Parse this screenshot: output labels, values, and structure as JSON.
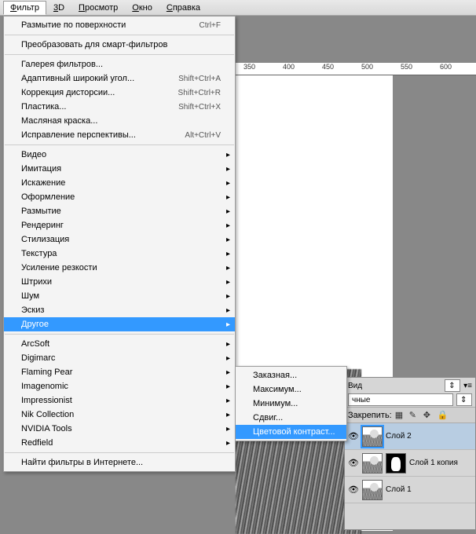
{
  "menubar": {
    "items": [
      {
        "label": "Фильтр",
        "u": 0,
        "active": true
      },
      {
        "label": "3D",
        "u": 0
      },
      {
        "label": "Просмотр",
        "u": 0
      },
      {
        "label": "Окно",
        "u": 0
      },
      {
        "label": "Справка",
        "u": 0
      }
    ]
  },
  "menu": {
    "items": [
      {
        "type": "item",
        "label": "Размытие по поверхности",
        "shortcut": "Ctrl+F"
      },
      {
        "type": "sep"
      },
      {
        "type": "item",
        "label": "Преобразовать для смарт-фильтров"
      },
      {
        "type": "sep"
      },
      {
        "type": "item",
        "label": "Галерея фильтров..."
      },
      {
        "type": "item",
        "label": "Адаптивный широкий угол...",
        "shortcut": "Shift+Ctrl+A"
      },
      {
        "type": "item",
        "label": "Коррекция дисторсии...",
        "shortcut": "Shift+Ctrl+R"
      },
      {
        "type": "item",
        "label": "Пластика...",
        "shortcut": "Shift+Ctrl+X"
      },
      {
        "type": "item",
        "label": "Масляная краска..."
      },
      {
        "type": "item",
        "label": "Исправление перспективы...",
        "shortcut": "Alt+Ctrl+V"
      },
      {
        "type": "sep"
      },
      {
        "type": "item",
        "label": "Видео",
        "sub": true
      },
      {
        "type": "item",
        "label": "Имитация",
        "sub": true
      },
      {
        "type": "item",
        "label": "Искажение",
        "sub": true
      },
      {
        "type": "item",
        "label": "Оформление",
        "sub": true
      },
      {
        "type": "item",
        "label": "Размытие",
        "sub": true
      },
      {
        "type": "item",
        "label": "Рендеринг",
        "sub": true
      },
      {
        "type": "item",
        "label": "Стилизация",
        "sub": true
      },
      {
        "type": "item",
        "label": "Текстура",
        "sub": true
      },
      {
        "type": "item",
        "label": "Усиление резкости",
        "sub": true
      },
      {
        "type": "item",
        "label": "Штрихи",
        "sub": true
      },
      {
        "type": "item",
        "label": "Шум",
        "sub": true
      },
      {
        "type": "item",
        "label": "Эскиз",
        "sub": true
      },
      {
        "type": "item",
        "label": "Другое",
        "sub": true,
        "highlight": true
      },
      {
        "type": "sep"
      },
      {
        "type": "item",
        "label": "ArcSoft",
        "sub": true
      },
      {
        "type": "item",
        "label": "Digimarc",
        "sub": true
      },
      {
        "type": "item",
        "label": "Flaming Pear",
        "sub": true
      },
      {
        "type": "item",
        "label": "Imagenomic",
        "sub": true
      },
      {
        "type": "item",
        "label": "Impressionist",
        "sub": true
      },
      {
        "type": "item",
        "label": "Nik Collection",
        "sub": true
      },
      {
        "type": "item",
        "label": "NVIDIA Tools",
        "sub": true
      },
      {
        "type": "item",
        "label": "Redfield",
        "sub": true
      },
      {
        "type": "sep"
      },
      {
        "type": "item",
        "label": "Найти фильтры в Интернете..."
      }
    ]
  },
  "submenu": {
    "items": [
      {
        "label": "Заказная..."
      },
      {
        "label": "Максимум..."
      },
      {
        "label": "Минимум..."
      },
      {
        "label": "Сдвиг..."
      },
      {
        "label": "Цветовой контраст...",
        "highlight": true
      }
    ]
  },
  "ruler": {
    "ticks": [
      "350",
      "400",
      "450",
      "500",
      "550",
      "600"
    ]
  },
  "panel": {
    "mode_label": "Вид",
    "blend_value": "чные",
    "lock_label": "Закрепить:",
    "layers": [
      {
        "name": "Слой 2",
        "selected": true,
        "mask": false
      },
      {
        "name": "Слой 1 копия",
        "selected": false,
        "mask": true
      },
      {
        "name": "Слой 1",
        "selected": false,
        "mask": false
      }
    ]
  }
}
